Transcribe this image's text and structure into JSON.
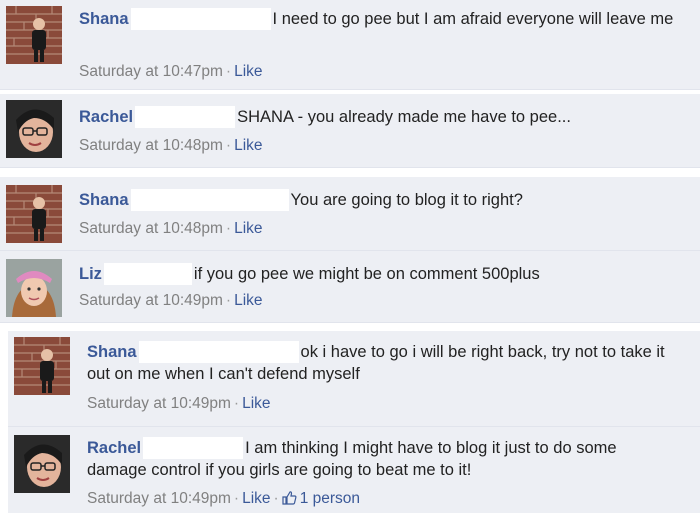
{
  "comments": [
    {
      "author": "Shana",
      "avatar": "brick-wall-child-avatar",
      "text": "I need to go pee but I am afraid everyone will leave me",
      "time": "Saturday at 10:47pm",
      "like": "Like"
    },
    {
      "author": "Rachel",
      "avatar": "woman-with-glasses-avatar",
      "text": "SHANA - you already made me have to pee...",
      "time": "Saturday at 10:48pm",
      "like": "Like"
    },
    {
      "author": "Shana",
      "avatar": "brick-wall-child-avatar",
      "text": "You are going to blog it to right?",
      "time": "Saturday at 10:48pm",
      "like": "Like"
    },
    {
      "author": "Liz",
      "avatar": "girl-with-pink-hat-avatar",
      "text": "if you go pee we might be on comment 500plus",
      "time": "Saturday at 10:49pm",
      "like": "Like"
    },
    {
      "author": "Shana",
      "avatar": "brick-wall-child-avatar",
      "text": "ok i have to go i will be right back, try not to take it out on me when I can't defend myself",
      "time": "Saturday at 10:49pm",
      "like": "Like"
    },
    {
      "author": "Rachel",
      "avatar": "woman-with-glasses-avatar",
      "text": "I am thinking I might have to blog it just to do some damage control if you girls are going to beat me to it!",
      "time": "Saturday at 10:49pm",
      "like": "Like",
      "likes_count": "1 person"
    }
  ],
  "colors": {
    "background": "#edeff4",
    "link": "#3b5998",
    "meta": "#808080"
  }
}
